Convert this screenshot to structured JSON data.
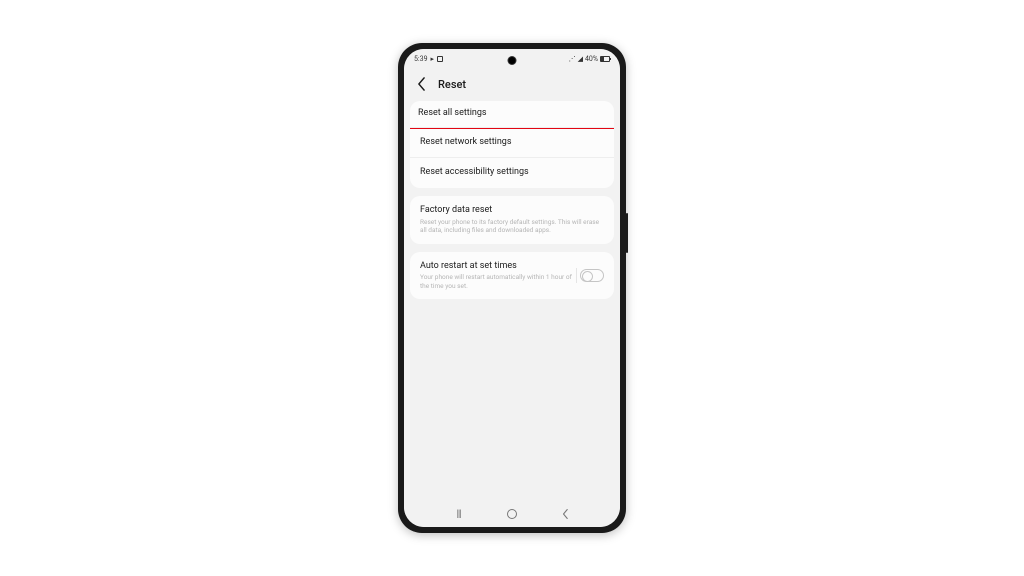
{
  "status_bar": {
    "time": "5:39",
    "battery_text": "40%"
  },
  "header": {
    "title": "Reset"
  },
  "group_reset": {
    "item_all": "Reset all settings",
    "item_network": "Reset network settings",
    "item_accessibility": "Reset accessibility settings"
  },
  "group_factory": {
    "title": "Factory data reset",
    "sub": "Reset your phone to its factory default settings. This will erase all data, including files and downloaded apps."
  },
  "group_auto": {
    "title": "Auto restart at set times",
    "sub": "Your phone will restart automatically within 1 hour of the time you set."
  }
}
